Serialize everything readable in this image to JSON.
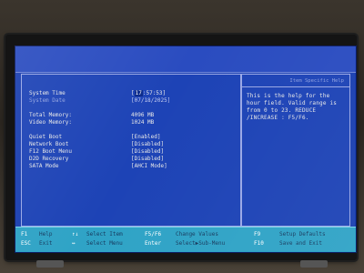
{
  "main": {
    "system_time_label": "System Time",
    "system_time_value": "[17:57:53]",
    "system_time_hour": "17",
    "system_time_rest": ":57:53]",
    "system_date_label": "System Date",
    "system_date_value": "[07/18/2025]",
    "total_memory_label": "Total Memory:",
    "total_memory_value": "4096 MB",
    "video_memory_label": "Video Memory:",
    "video_memory_value": "1024 MB",
    "quiet_boot_label": "Quiet Boot",
    "quiet_boot_value": "[Enabled]",
    "network_boot_label": "Network Boot",
    "network_boot_value": "[Disabled]",
    "f12_boot_menu_label": "F12 Boot Menu",
    "f12_boot_menu_value": "[Disabled]",
    "d2d_recovery_label": "D2D Recovery",
    "d2d_recovery_value": "[Disabled]",
    "sata_mode_label": "SATA Mode",
    "sata_mode_value": "[AHCI Mode]"
  },
  "help": {
    "header": "Item Specific Help",
    "text": "This is the help for the hour field. Valid range is from 0 to 23. REDUCE /INCREASE : F5/F6."
  },
  "footer": {
    "f1_key": "F1",
    "f1_label": "Help",
    "esc_key": "ESC",
    "esc_label": "Exit",
    "updown_key": "↑↓",
    "updown_label": "Select Item",
    "leftright_key": "↔",
    "leftright_label": "Select Menu",
    "f5f6_key": "F5/F6",
    "f5f6_label": "Change Values",
    "enter_key": "Enter",
    "enter_label": "Select▶Sub-Menu",
    "f9_key": "F9",
    "f9_label": "Setup Defaults",
    "f10_key": "F10",
    "f10_label": "Save and Exit"
  },
  "colors": {
    "screen_bg": "#1a3fb0",
    "footer_bg": "#2fa3c6",
    "text": "#e8e8e8",
    "dim_text": "#8fa0e0"
  }
}
